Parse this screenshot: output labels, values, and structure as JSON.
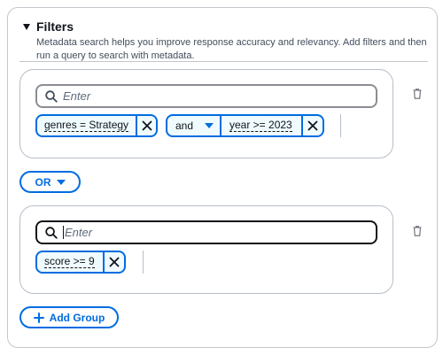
{
  "filters": {
    "title": "Filters",
    "description": "Metadata search helps you improve response accuracy and relevancy. Add filters and then run a query to search with metadata."
  },
  "groups": [
    {
      "search_placeholder": "Enter",
      "tokens": [
        {
          "label": "genres = Strategy"
        }
      ],
      "join": {
        "operator": "and",
        "label": "year >= 2023"
      }
    },
    {
      "search_placeholder": "Enter",
      "tokens": [
        {
          "label": "score >= 9"
        }
      ]
    }
  ],
  "group_operator": "OR",
  "add_group_label": "Add Group",
  "colors": {
    "accent": "#006ce0",
    "token_bg": "#f0fbff",
    "border": "#b6bec9",
    "text": "#0f141a"
  }
}
